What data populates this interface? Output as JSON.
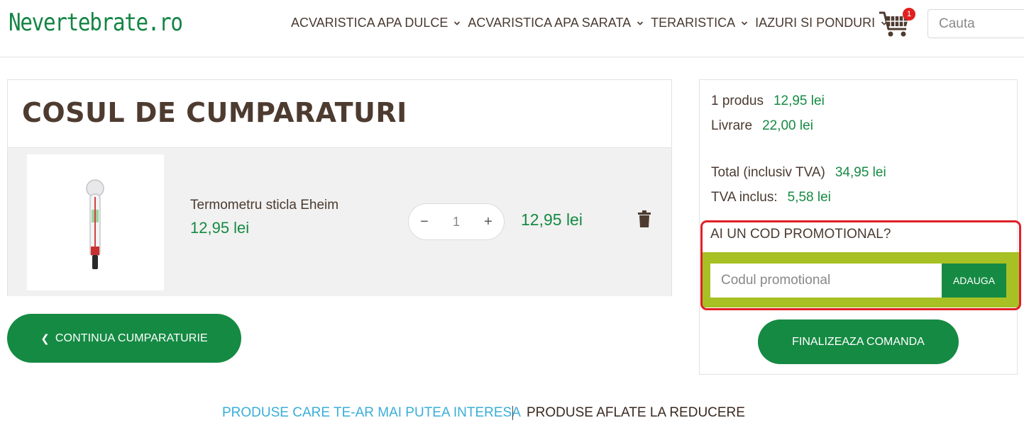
{
  "header": {
    "logo": "Nevertebrate.ro",
    "nav": [
      {
        "label": "ACVARISTICA APA DULCE"
      },
      {
        "label": "ACVARISTICA APA SARATA"
      },
      {
        "label": "TERARISTICA"
      },
      {
        "label": "IAZURI SI PONDURI"
      }
    ],
    "cart_count": "1",
    "search_placeholder": "Cauta"
  },
  "cart": {
    "title": "COSUL DE CUMPARATURI",
    "item": {
      "name": "Termometru sticla Eheim",
      "price": "12,95 lei",
      "quantity": "1",
      "decrement": "−",
      "increment": "+",
      "total": "12,95 lei",
      "image_icon": "thermometer-image"
    },
    "continue_label": "CONTINUA CUMPARATURIE"
  },
  "summary": {
    "products_label": "1 produs",
    "products_value": "12,95 lei",
    "shipping_label": "Livrare",
    "shipping_value": "22,00 lei",
    "total_label": "Total (inclusiv TVA)",
    "total_value": "34,95 lei",
    "vat_label": "TVA inclus:",
    "vat_value": "5,58 lei",
    "promo_title": "AI UN COD PROMOTIONAL?",
    "promo_placeholder": "Codul promotional",
    "promo_button": "ADAUGA",
    "finalize_label": "FINALIZEAZA COMANDA"
  },
  "tabs": {
    "interesting": "PRODUSE CARE TE-AR MAI PUTEA INTERESA",
    "discounted": "PRODUSE AFLATE LA REDUCERE"
  },
  "colors": {
    "brand_green": "#158a43",
    "promo_band": "#a7c023",
    "highlight_red": "#e02028",
    "tab_active": "#3aaed8"
  }
}
